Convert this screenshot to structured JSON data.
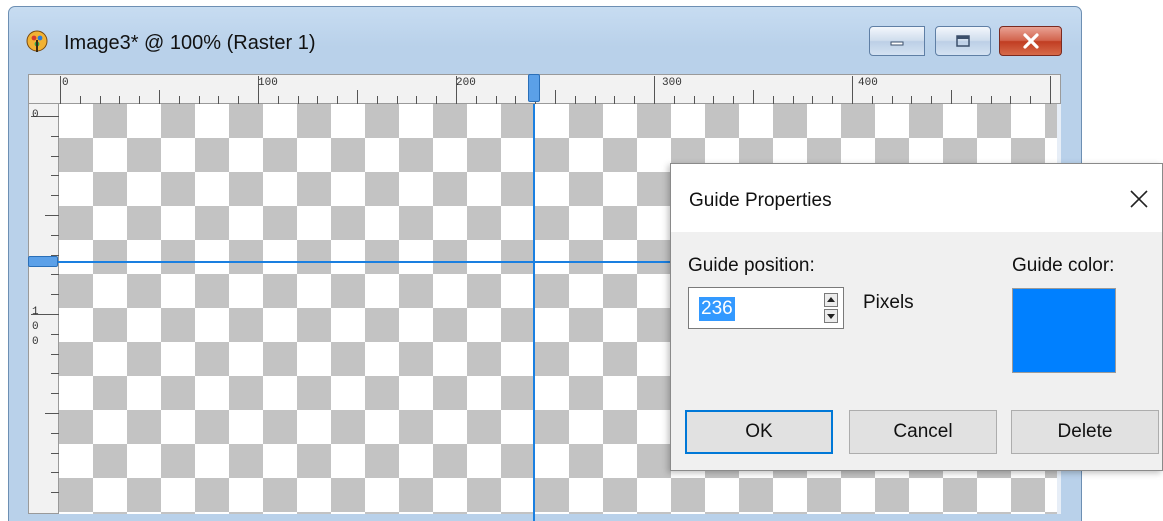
{
  "window": {
    "title": "Image3* @ 100% (Raster 1)",
    "icon": "paintshop-pro-icon",
    "controls": [
      "minimize-icon",
      "maximize-icon",
      "close-icon"
    ]
  },
  "ruler_top": {
    "labels": [
      "0",
      "100",
      "200",
      "300",
      "400"
    ]
  },
  "ruler_left": {
    "labels": [
      "0",
      "1",
      "0",
      "0"
    ]
  },
  "guides": {
    "color": "#1a7fe0"
  },
  "dialog": {
    "title": "Guide Properties",
    "position_label": "Guide position:",
    "position_value": "236",
    "unit_label": "Pixels",
    "color_label": "Guide color:",
    "guide_color": "#0080ff",
    "ok_label": "OK",
    "cancel_label": "Cancel",
    "delete_label": "Delete"
  }
}
